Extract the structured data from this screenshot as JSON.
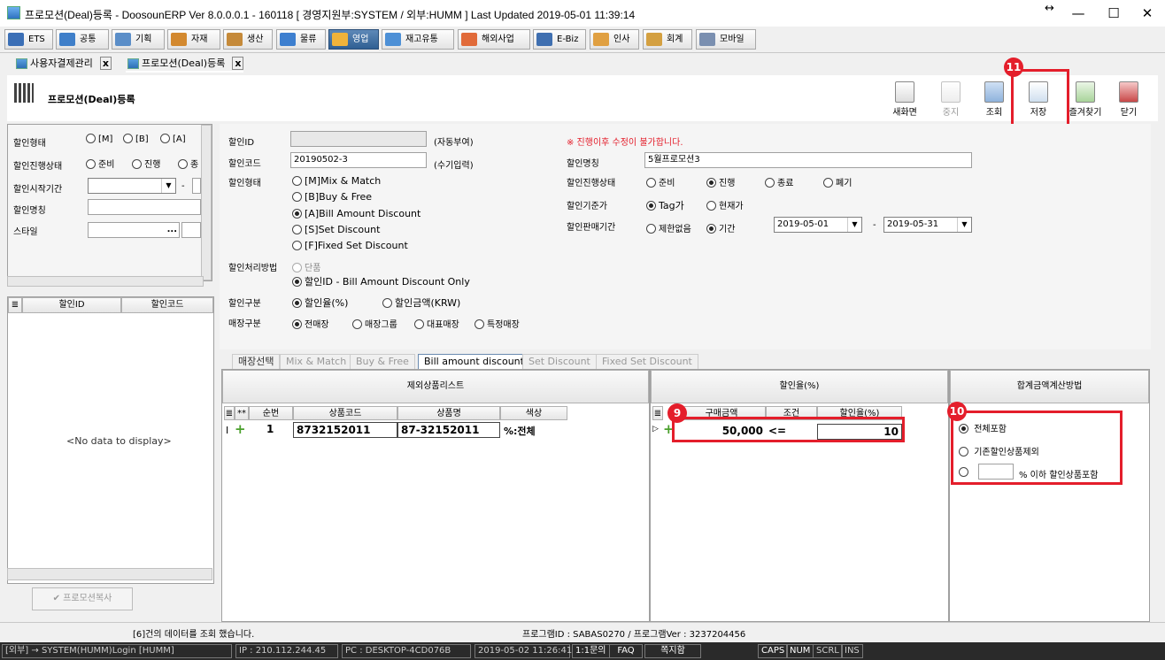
{
  "window": {
    "title": "프로모션(Deal)등록 - DoosounERP Ver 8.0.0.0.1 - 160118 [ 경영지원부:SYSTEM / 외부:HUMM ]   Last Updated 2019-05-01 11:39:14",
    "minimize": "—",
    "maximize": "☐",
    "close": "✕",
    "restore": "↔"
  },
  "menu": [
    {
      "label": "ETS",
      "color": "#3b6fb6"
    },
    {
      "label": "공통",
      "color": "#3f7fc9"
    },
    {
      "label": "기획",
      "color": "#5b8ec8"
    },
    {
      "label": "자재",
      "color": "#d3892f"
    },
    {
      "label": "생산",
      "color": "#c58a3a"
    },
    {
      "label": "물류",
      "color": "#3d7fcf"
    },
    {
      "label": "영업",
      "color": "#f0b33a"
    },
    {
      "label": "재고유통",
      "color": "#4d90d6"
    },
    {
      "label": "해외사업",
      "color": "#e16b3a"
    },
    {
      "label": "E-Biz",
      "color": "#3f6fb0"
    },
    {
      "label": "인사",
      "color": "#e0a042"
    },
    {
      "label": "회계",
      "color": "#d4a041"
    },
    {
      "label": "모바일",
      "color": "#7a8fb0"
    }
  ],
  "doc_tabs": [
    {
      "label": "사용자결제관리",
      "close": "x"
    },
    {
      "label": "프로모션(Deal)등록",
      "close": "x"
    }
  ],
  "page_title": "프로모션(Deal)등록",
  "toolbar": {
    "new": "새화면",
    "stop": "중지",
    "query": "조회",
    "save": "저장",
    "fav": "즐겨찾기",
    "close": "닫기"
  },
  "left_filters": {
    "type_label": "할인형태",
    "type_opts": [
      "[M]",
      "[B]",
      "[A]"
    ],
    "state_label": "할인진행상태",
    "state_opts": [
      "준비",
      "진행",
      "종"
    ],
    "start_label": "할인시작기간",
    "start_sep": "-",
    "name_label": "할인명칭",
    "style_label": "스타일",
    "style_btn": "..."
  },
  "left_grid": {
    "col_id": "할인ID",
    "col_code": "할인코드",
    "empty": "<No data to display>",
    "copy_btn": "프로모션복사"
  },
  "form": {
    "id_label": "할인ID",
    "id_note": "(자동부여)",
    "warning": "※ 진행이후 수정이 불가합니다.",
    "code_label": "할인코드",
    "code_value": "20190502-3",
    "code_note": "(수기입력)",
    "name_label": "할인명칭",
    "name_value": "5월프로모션3",
    "type_label": "할인형태",
    "type_opts": [
      "[M]Mix & Match",
      "[B]Buy & Free",
      "[A]Bill Amount Discount",
      "[S]Set Discount",
      "[F]Fixed Set Discount"
    ],
    "state_label": "할인진행상태",
    "state_opts": [
      "준비",
      "진행",
      "종료",
      "폐기"
    ],
    "base_label": "할인기준가",
    "base_opts": [
      "Tag가",
      "현재가"
    ],
    "period_label": "할인판매기간",
    "period_opts": [
      "제한없음",
      "기간"
    ],
    "date_from": "2019-05-01",
    "date_sep": "-",
    "date_to": "2019-05-31",
    "method_label": "할인처리방법",
    "method_opts": [
      "단품",
      "할인ID - Bill Amount Discount Only"
    ],
    "kind_label": "할인구분",
    "kind_opts": [
      "할인율(%)",
      "할인금액(KRW)"
    ],
    "store_label": "매장구분",
    "store_opts": [
      "전매장",
      "매장그룹",
      "대표매장",
      "특정매장"
    ]
  },
  "sub_tabs": [
    "매장선택",
    "Mix & Match",
    "Buy & Free",
    "Bill amount discount",
    "Set Discount",
    "Fixed Set Discount"
  ],
  "exclude": {
    "title": "제외상품리스트",
    "cols": [
      "**",
      "순번",
      "상품코드",
      "상품명",
      "색상"
    ],
    "row": {
      "seq": "1",
      "code": "8732152011",
      "name": "87-32152011",
      "color": "%:전체"
    }
  },
  "rate": {
    "title": "할인율(%)",
    "cols": [
      "구매금액",
      "조건",
      "할인율(%)"
    ],
    "row": {
      "amount": "50,000",
      "cond": "<=",
      "rate": "10"
    }
  },
  "sum": {
    "title": "합계금액계산방법",
    "opts": [
      "전체포함",
      "기존할인상품제외"
    ],
    "opt3_suffix": "% 이하 할인상품포함"
  },
  "badges": {
    "b9": "9",
    "b10": "10",
    "b11": "11"
  },
  "message": {
    "left": "[6]건의 데이터를 조회 했습니다.",
    "right": "프로그램ID : SABAS0270 / 프로그램Ver : 3237204456"
  },
  "status": {
    "user": "[외부] → SYSTEM(HUMM)Login [HUMM]",
    "ip": "IP : 210.112.244.45",
    "pc": "PC : DESKTOP-4CD076B",
    "time": "2019-05-02 11:26:41",
    "qna": "1:1문의",
    "faq": "FAQ",
    "note": "쪽지함",
    "caps": "CAPS",
    "num": "NUM",
    "scrl": "SCRL",
    "ins": "INS"
  }
}
